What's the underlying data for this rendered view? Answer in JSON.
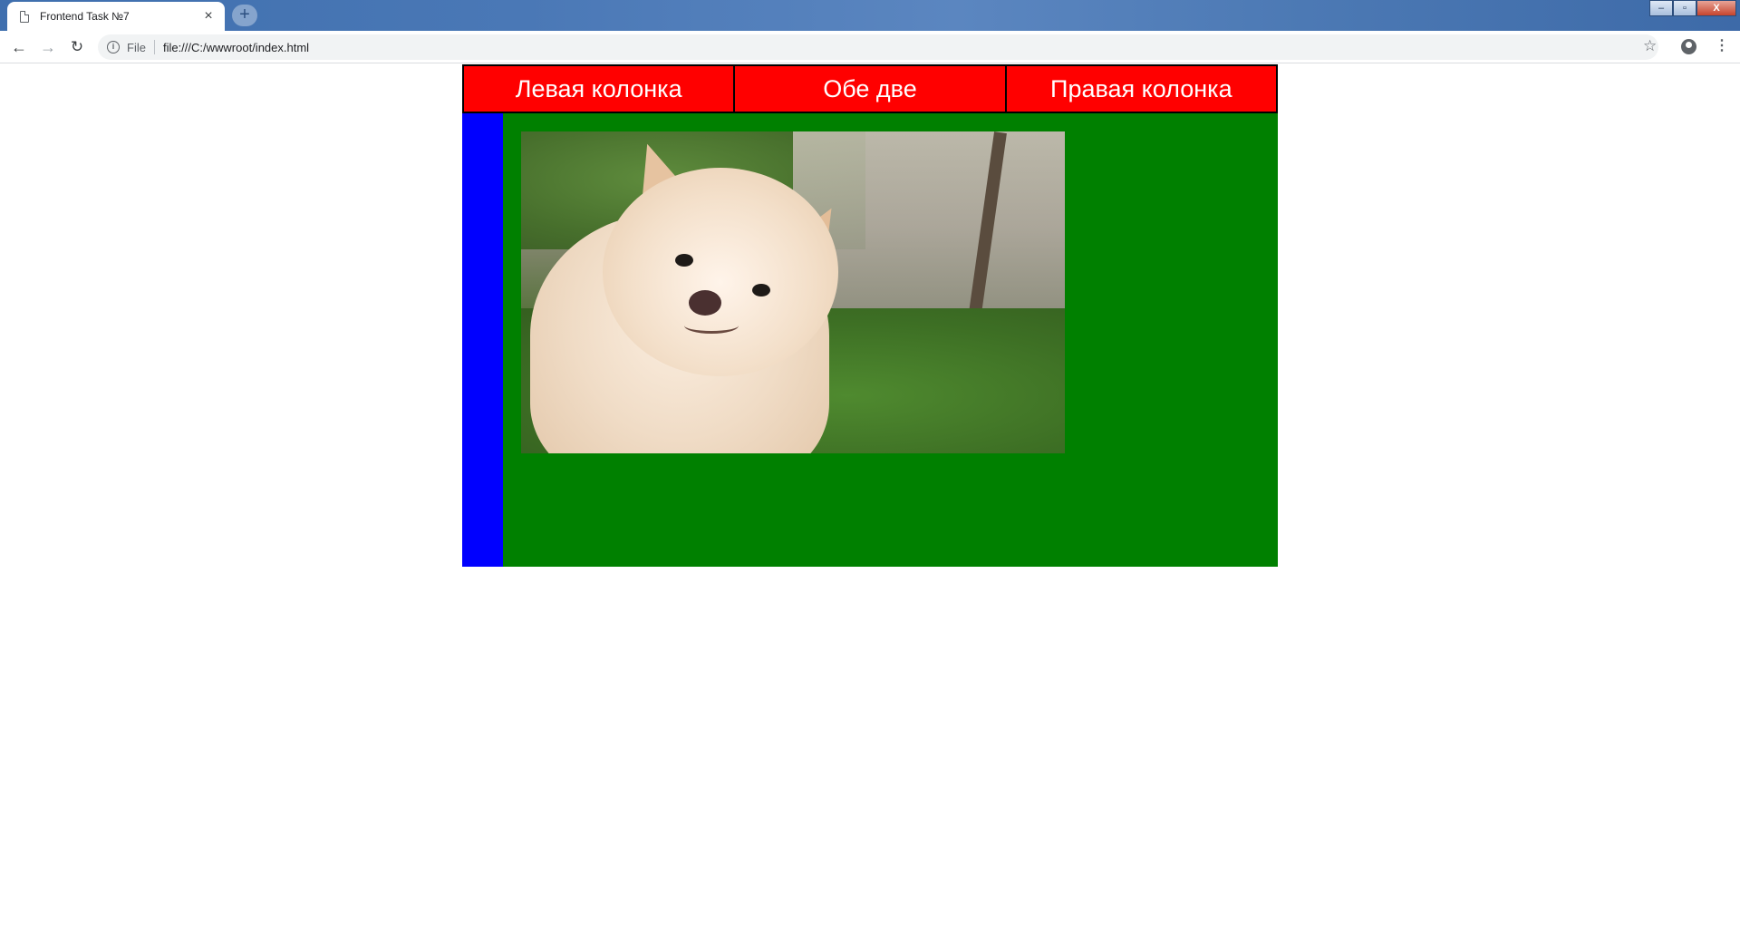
{
  "browser": {
    "tab_title": "Frontend Task №7",
    "tab_close": "×",
    "new_tab": "+",
    "scheme_label": "File",
    "url": "file:///C:/wwwroot/index.html",
    "info_glyph": "i",
    "back_glyph": "←",
    "forward_glyph": "→",
    "reload_glyph": "↻",
    "star_glyph": "☆",
    "menu_glyph": "⋮",
    "window_controls": {
      "minimize": "–",
      "maximize": "▫",
      "close": "X"
    }
  },
  "page": {
    "tabs": [
      "Левая колонка",
      "Обе две",
      "Правая колонка"
    ],
    "photo_subject": "pomeranian-dog-photo"
  },
  "colors": {
    "tab_bg": "#ff0000",
    "left_column": "#0000ff",
    "main_column": "#008000"
  }
}
